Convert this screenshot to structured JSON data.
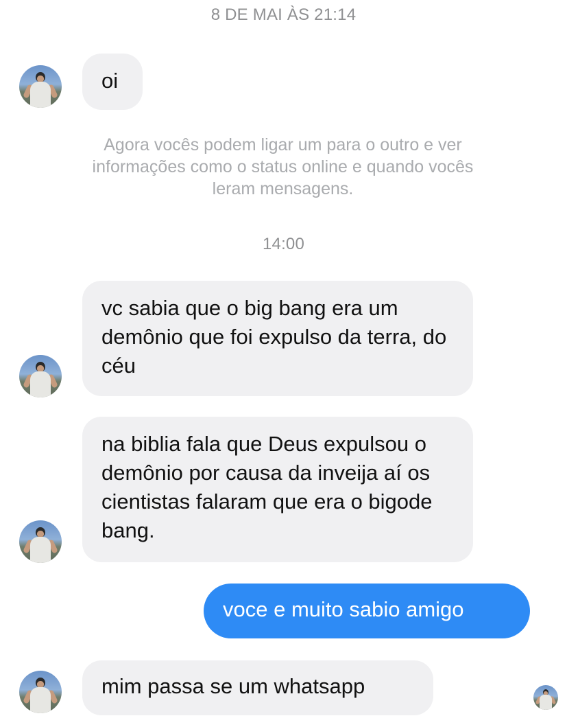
{
  "conversation": {
    "header_timestamp": "8 DE MAI ÀS 21:14",
    "system_note": "Agora vocês podem ligar um para o outro e ver informações como o status online e quando vocês leram mensagens.",
    "second_timestamp": "14:00",
    "messages": [
      {
        "direction": "incoming",
        "text": "oi"
      },
      {
        "direction": "incoming",
        "text": "vc sabia que o big bang era um demônio que foi expulso da terra, do céu"
      },
      {
        "direction": "incoming",
        "text": "na biblia fala que Deus expulsou o demônio por causa da inveija aí os cientistas falaram que era o bigode bang."
      },
      {
        "direction": "outgoing",
        "text": "voce e muito sabio amigo"
      },
      {
        "direction": "incoming",
        "text": "mim passa se um whatsapp"
      }
    ]
  },
  "colors": {
    "incoming_bubble": "#f0f0f2",
    "outgoing_bubble": "#2e8bf5",
    "timestamp_text": "#8f9092"
  },
  "icons": {
    "contact_avatar": "contact-avatar-photo",
    "read_receipt_avatar": "read-receipt-avatar"
  }
}
